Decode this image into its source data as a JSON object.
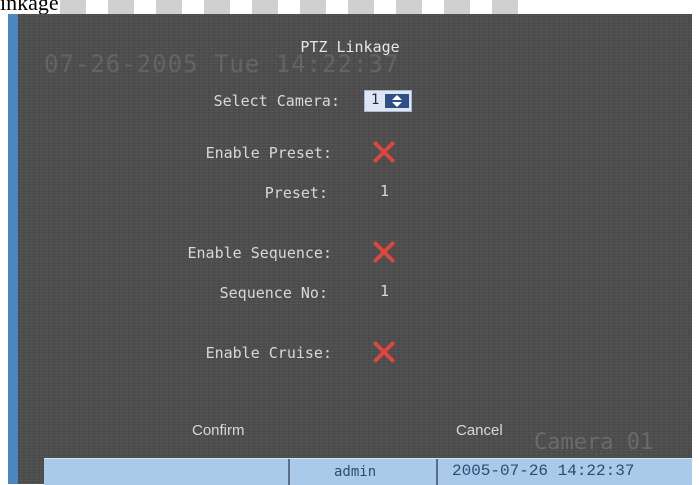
{
  "caption": "inkage",
  "overlay": {
    "date": "07-26-2005 Tue 14:22:37",
    "camera": "Camera 01"
  },
  "dialog": {
    "title": "PTZ Linkage",
    "select_camera_label": "Select Camera:",
    "select_camera_value": "1",
    "enable_preset_label": "Enable Preset:",
    "enable_preset_state": "disabled",
    "preset_label": "Preset:",
    "preset_value": "1",
    "enable_sequence_label": "Enable Sequence:",
    "enable_sequence_state": "disabled",
    "sequence_no_label": "Sequence No:",
    "sequence_no_value": "1",
    "enable_cruise_label": "Enable Cruise:",
    "enable_cruise_state": "disabled",
    "confirm_label": "Confirm",
    "cancel_label": "Cancel"
  },
  "status": {
    "user": "admin",
    "datetime": "2005-07-26 14:22:37"
  },
  "icons": {
    "checkbox_off": "x-mark-icon",
    "spinner": "up-down-arrow-icon"
  },
  "colors": {
    "screen_bg": "#4e4e4e",
    "x_mark": "#d9473e",
    "status_bar": "#a9cbe9",
    "left_bar": "#4a86c0"
  }
}
